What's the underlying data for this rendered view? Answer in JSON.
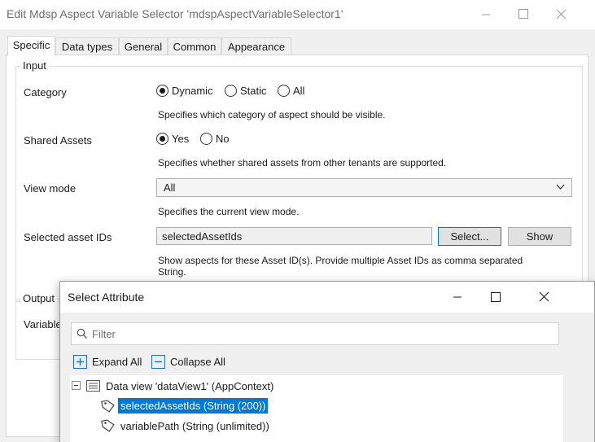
{
  "window": {
    "title": "Edit Mdsp Aspect Variable Selector 'mdspAspectVariableSelector1'"
  },
  "tabs": [
    {
      "label": "Specific"
    },
    {
      "label": "Data types"
    },
    {
      "label": "General"
    },
    {
      "label": "Common"
    },
    {
      "label": "Appearance"
    }
  ],
  "input_group": {
    "legend": "Input",
    "category": {
      "label": "Category",
      "options": [
        "Dynamic",
        "Static",
        "All"
      ],
      "selected": "Dynamic",
      "description": "Specifies which category of aspect should be visible."
    },
    "shared_assets": {
      "label": "Shared Assets",
      "options": [
        "Yes",
        "No"
      ],
      "selected": "Yes",
      "description": "Specifies whether shared assets from other tenants are supported."
    },
    "view_mode": {
      "label": "View mode",
      "value": "All",
      "description": "Specifies the current view mode."
    },
    "selected_asset_ids": {
      "label": "Selected asset IDs",
      "value": "selectedAssetIds",
      "select_button": "Select...",
      "show_button": "Show",
      "description_line1": "Show aspects for these Asset ID(s). Provide multiple Asset IDs as comma separated",
      "description_line2": "String."
    }
  },
  "output_group": {
    "legend": "Output",
    "variable_label": "Variable"
  },
  "popup": {
    "title": "Select Attribute",
    "filter_placeholder": "Filter",
    "expand_all": "Expand All",
    "collapse_all": "Collapse All",
    "tree": {
      "root": "Data view 'dataView1' (AppContext)",
      "items": [
        {
          "label": "selectedAssetIds (String (200))",
          "selected": true
        },
        {
          "label": "variablePath (String (unlimited))",
          "selected": false
        }
      ]
    }
  },
  "colors": {
    "selection": "#0078d7",
    "dialog_bg": "#f0f0f0"
  }
}
